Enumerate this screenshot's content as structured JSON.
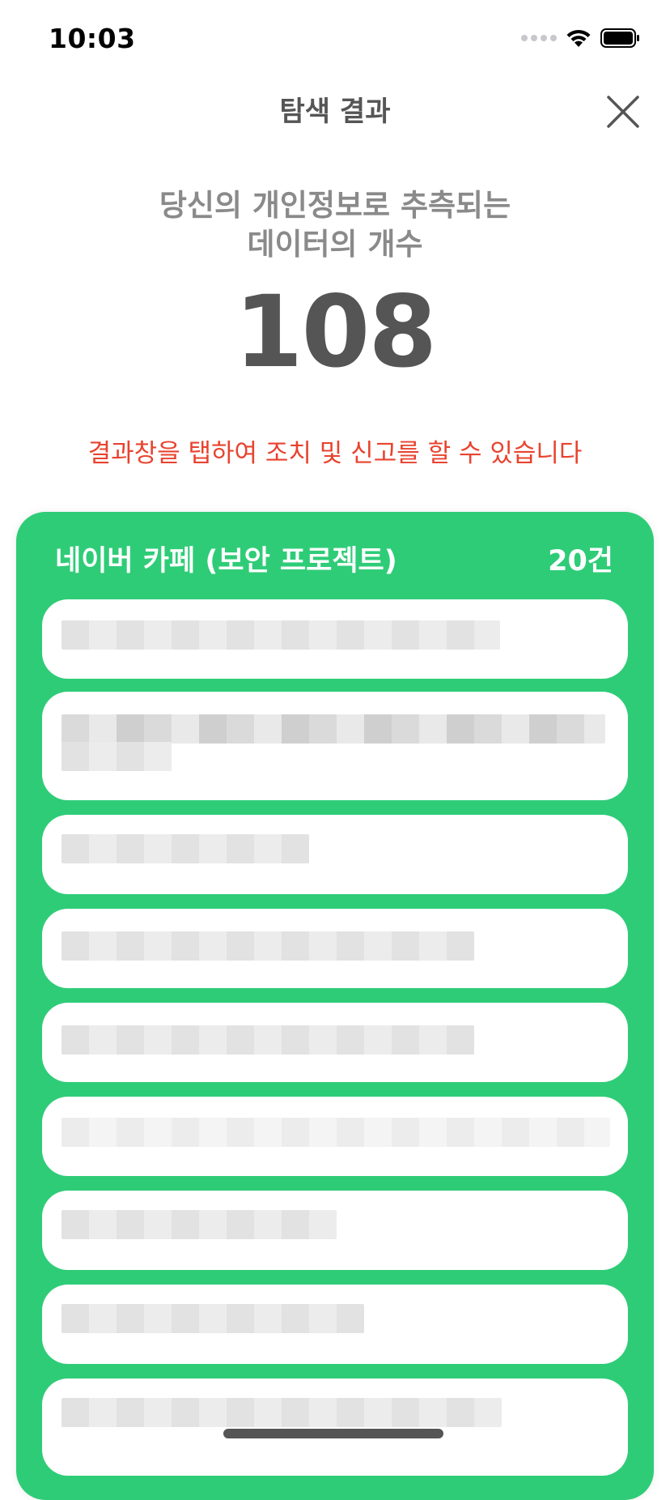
{
  "status_bar": {
    "time": "10:03",
    "icons": [
      "cellular-signal-icon",
      "wifi-icon",
      "battery-icon"
    ]
  },
  "header": {
    "title": "탐색 결과",
    "close_icon": "close-icon"
  },
  "summary": {
    "line1": "당신의 개인정보로 추측되는",
    "line2": "데이터의 개수",
    "count": "108",
    "hint": "결과창을 탭하여 조치 및 신고를 할 수 있습니다"
  },
  "result_group": {
    "title": "네이버 카페 (보안 프로젝트)",
    "count": "20건",
    "color": "#2fcc78",
    "items_note_hidden": true,
    "visible_item_count": 9
  },
  "colors": {
    "accent_green": "#2fcc78",
    "warning_red": "#e8432f",
    "title_gray": "#555555",
    "subtitle_gray": "#8a8a8a"
  }
}
